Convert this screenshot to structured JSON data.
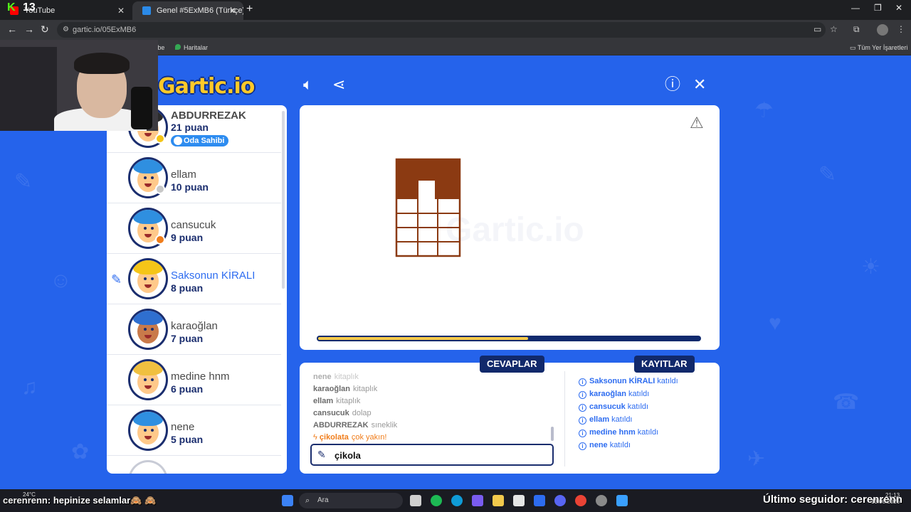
{
  "browser": {
    "tabs": [
      {
        "label": "YouTube",
        "active": false
      },
      {
        "label": "Genel #5ExMB6 (Türkçe) - Gartic",
        "active": true
      }
    ],
    "url": "gartic.io/05ExMB6",
    "bookmarks": [
      {
        "label": "YouTube"
      },
      {
        "label": "Haritalar"
      }
    ],
    "all_bookmarks_label": "Tüm Yer İşaretleri"
  },
  "stream": {
    "kick_viewers": "13",
    "weather": "24°C",
    "chat_user": "cerenrenn",
    "chat_message": ": hepinize selamlar🙈 🙈",
    "last_follower": "Último seguidor: cerenrenn",
    "clock_time": "21:13",
    "clock_date": "13.08.2026"
  },
  "taskbar": {
    "search_placeholder": "Ara"
  },
  "game": {
    "logo": "Gartic.io",
    "watermark": "Gartic.io",
    "players": [
      {
        "name": "ABDURREZAK",
        "score": "21 puan",
        "badge": "Oda Sahibi",
        "status": "#f5c518",
        "hair": "#2b2b2b",
        "drawing": false
      },
      {
        "name": "ellam",
        "score": "10 puan",
        "badge": "",
        "status": "#c8c8c8",
        "hair": "#2f8fe0",
        "drawing": false
      },
      {
        "name": "cansucuk",
        "score": "9 puan",
        "badge": "",
        "status": "#f07d1b",
        "hair": "#2f8fe0",
        "drawing": false
      },
      {
        "name": "Saksonun KİRALI",
        "score": "8 puan",
        "badge": "",
        "status": "",
        "hair": "#f5c518",
        "drawing": true
      },
      {
        "name": "karaoğlan",
        "score": "7 puan",
        "badge": "",
        "status": "",
        "hair": "#2f6fd0",
        "drawing": false
      },
      {
        "name": "medine hnm",
        "score": "6 puan",
        "badge": "",
        "status": "",
        "hair": "#f0c040",
        "drawing": false
      },
      {
        "name": "nene",
        "score": "5 puan",
        "badge": "",
        "status": "",
        "hair": "#2f8fe0",
        "drawing": false
      }
    ],
    "round_progress": 0.55,
    "answers_label": "CEVAPLAR",
    "logs_label": "KAYITLAR",
    "answers": [
      {
        "user": "nene",
        "text": "kitaplık",
        "close": false
      },
      {
        "user": "karaoğlan",
        "text": "kitaplık",
        "close": false
      },
      {
        "user": "ellam",
        "text": "kitaplık",
        "close": false
      },
      {
        "user": "cansucuk",
        "text": "dolap",
        "close": false
      },
      {
        "user": "ABDURREZAK",
        "text": "sıneklik",
        "close": false
      },
      {
        "user": "çikolata",
        "text": "çok yakın!",
        "close": true
      }
    ],
    "answer_input_value": "çikola",
    "logs": [
      {
        "user": "Saksonun KİRALI",
        "text": "katıldı"
      },
      {
        "user": "karaoğlan",
        "text": "katıldı"
      },
      {
        "user": "cansucuk",
        "text": "katıldı"
      },
      {
        "user": "ellam",
        "text": "katıldı"
      },
      {
        "user": "medine hnm",
        "text": "katıldı"
      },
      {
        "user": "nene",
        "text": "katıldı"
      }
    ],
    "drawing_color": "#8b3a12"
  }
}
